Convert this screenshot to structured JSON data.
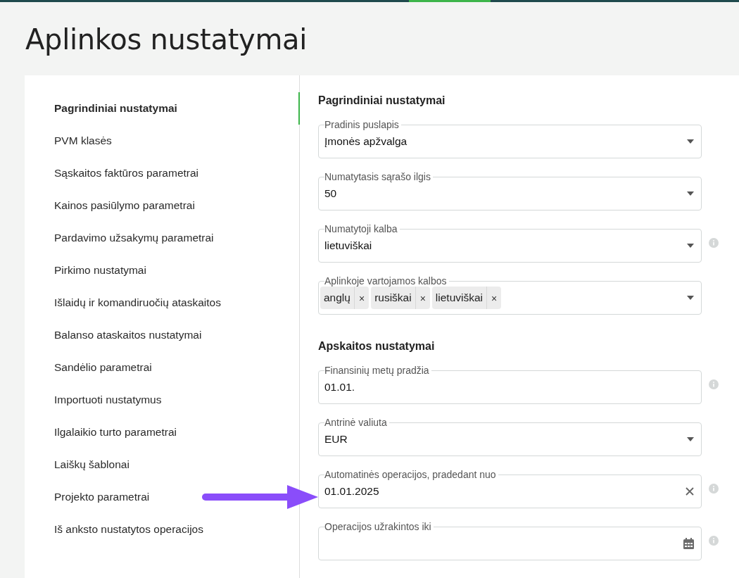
{
  "title": "Aplinkos nustatymai",
  "sidebar": {
    "items": [
      {
        "label": "Pagrindiniai nustatymai",
        "selected": true
      },
      {
        "label": "PVM klasės",
        "selected": false
      },
      {
        "label": "Sąskaitos faktūros parametrai",
        "selected": false
      },
      {
        "label": "Kainos pasiūlymo parametrai",
        "selected": false
      },
      {
        "label": "Pardavimo užsakymų parametrai",
        "selected": false
      },
      {
        "label": "Pirkimo nustatymai",
        "selected": false
      },
      {
        "label": "Išlaidų ir komandiruočių ataskaitos",
        "selected": false
      },
      {
        "label": "Balanso ataskaitos nustatymai",
        "selected": false
      },
      {
        "label": "Sandėlio parametrai",
        "selected": false
      },
      {
        "label": "Importuoti nustatymus",
        "selected": false
      },
      {
        "label": "Ilgalaikio turto parametrai",
        "selected": false
      },
      {
        "label": "Laiškų šablonai",
        "selected": false
      },
      {
        "label": "Projekto parametrai",
        "selected": false
      },
      {
        "label": "Iš anksto nustatytos operacijos",
        "selected": false
      }
    ]
  },
  "sections": [
    {
      "heading": "Pagrindiniai nustatymai",
      "fields": [
        {
          "kind": "select",
          "label": "Pradinis puslapis",
          "value": "Įmonės apžvalga",
          "info": false
        },
        {
          "kind": "select",
          "label": "Numatytasis sąrašo ilgis",
          "value": "50",
          "info": false
        },
        {
          "kind": "select",
          "label": "Numatytoji kalba",
          "value": "lietuviškai",
          "info": true
        },
        {
          "kind": "multiselect",
          "label": "Aplinkoje vartojamos kalbos",
          "tags": [
            {
              "label": "anglų",
              "remove": "×"
            },
            {
              "label": "rusiškai",
              "remove": "×"
            },
            {
              "label": "lietuviškai",
              "remove": "×"
            }
          ],
          "info": false
        }
      ]
    },
    {
      "heading": "Apskaitos nustatymai",
      "fields": [
        {
          "kind": "text",
          "label": "Finansinių metų pradžia",
          "value": "01.01.",
          "info": true
        },
        {
          "kind": "select",
          "label": "Antrinė valiuta",
          "value": "EUR",
          "info": false
        },
        {
          "kind": "clearable",
          "label": "Automatinės operacijos, pradedant nuo",
          "value": "01.01.2025",
          "info": true
        },
        {
          "kind": "date",
          "label": "Operacijos užrakintos iki",
          "info": true
        }
      ]
    }
  ]
}
